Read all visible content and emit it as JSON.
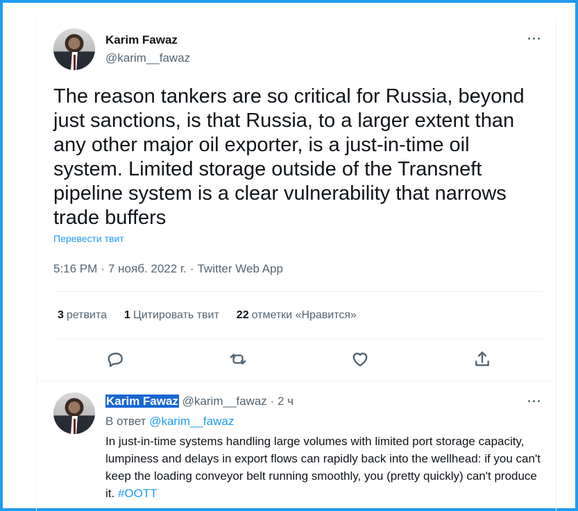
{
  "main_tweet": {
    "display_name": "Karim Fawaz",
    "handle": "@karim__fawaz",
    "more": "···",
    "text": "The reason tankers are so critical for Russia, beyond just sanctions, is that Russia, to a larger extent than any other major oil exporter, is a just-in-time oil system. Limited storage outside of the Transneft pipeline system is a clear vulnerability that narrows trade buffers",
    "translate_link": "Перевести твит",
    "time": "5:16 PM",
    "separator": "·",
    "date": "7 нояб. 2022 г.",
    "source": "Twitter Web App",
    "stats": [
      {
        "count": "3",
        "label": "ретвита"
      },
      {
        "count": "1",
        "label": "Цитировать твит"
      },
      {
        "count": "22",
        "label": "отметки «Нравится»"
      }
    ],
    "actions": [
      "reply-icon",
      "retweet-icon",
      "heart-icon",
      "share-icon"
    ]
  },
  "reply_tweet": {
    "display_name": "Karim Fawaz",
    "handle": "@karim__fawaz",
    "separator": "·",
    "time_ago": "2 ч",
    "more": "···",
    "reply_prefix": "В ответ",
    "reply_target": "@karim__fawaz",
    "text": "In just-in-time systems handling large volumes with limited port storage capacity, lumpiness and delays in export flows can rapidly back into the wellhead: if you can't keep the loading conveyor belt running smoothly, you (pretty quickly) can't produce it. ",
    "hashtag": "#OOTT"
  },
  "colors": {
    "accent": "#1d9bf0",
    "frame_border": "#1d9bf0",
    "secondary_text": "#536471",
    "primary_text": "#0f1419",
    "selection_highlight": "#1967d2"
  }
}
